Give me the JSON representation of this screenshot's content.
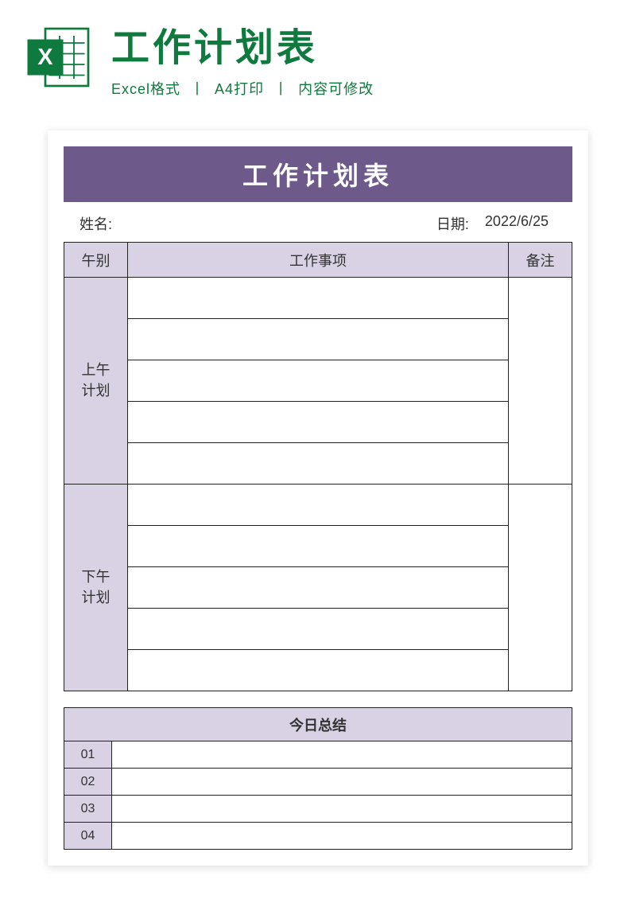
{
  "header": {
    "main_title": "工作计划表",
    "subtitle_parts": [
      "Excel格式",
      "A4打印",
      "内容可修改"
    ]
  },
  "document": {
    "title": "工作计划表",
    "name_label": "姓名:",
    "date_label": "日期:",
    "date_value": "2022/6/25",
    "columns": {
      "period": "午别",
      "work_items": "工作事项",
      "remarks": "备注"
    },
    "periods": {
      "morning": "上午\n计划",
      "afternoon": "下午\n计划"
    },
    "summary": {
      "title": "今日总结",
      "rows": [
        "01",
        "02",
        "03",
        "04"
      ]
    }
  }
}
